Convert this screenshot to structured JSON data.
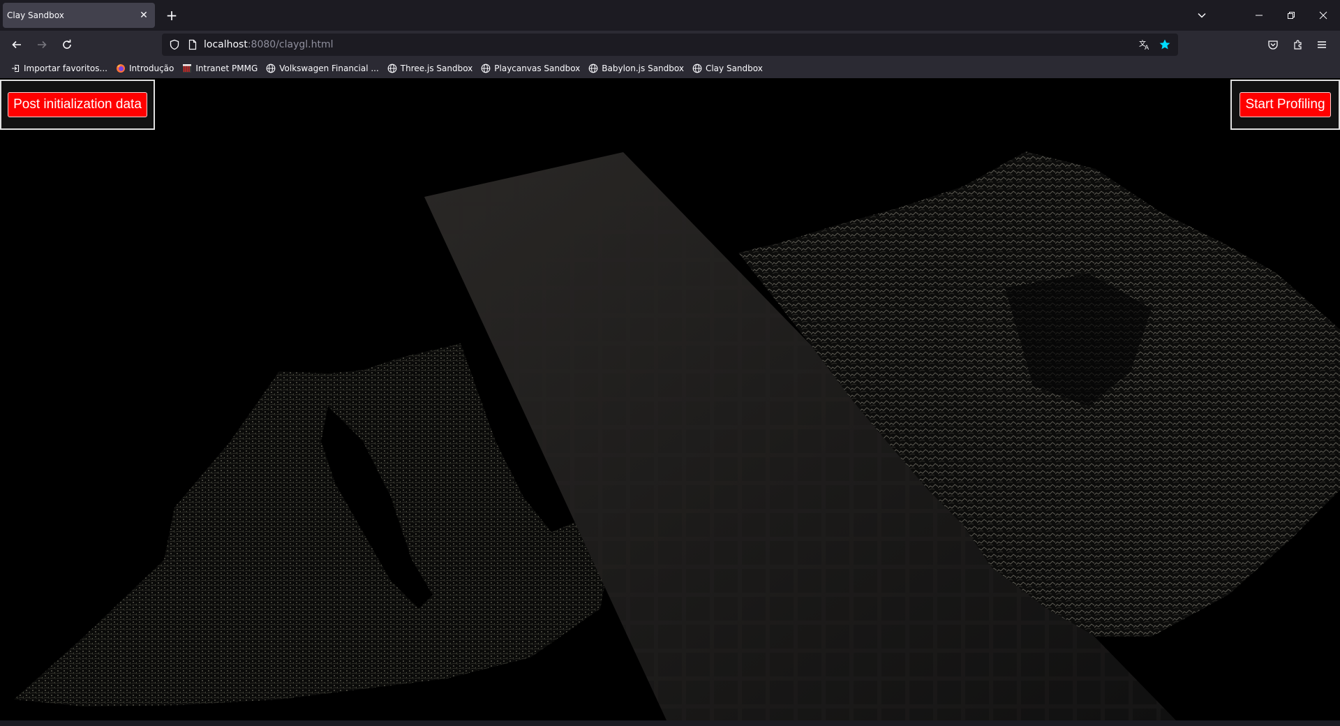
{
  "browser": {
    "tab": {
      "title": "Clay Sandbox",
      "close_icon": "close-icon"
    },
    "new_tab_label": "+",
    "url": {
      "host": "localhost",
      "rest": ":8080/claygl.html"
    },
    "bookmarks": [
      {
        "label": "Importar favoritos...",
        "icon": "import-icon"
      },
      {
        "label": "Introdução",
        "icon": "firefox-icon"
      },
      {
        "label": "Intranet PMMG",
        "icon": "pmmg-icon"
      },
      {
        "label": "Volkswagen Financial ...",
        "icon": "globe-icon"
      },
      {
        "label": "Three.js Sandbox",
        "icon": "globe-icon"
      },
      {
        "label": "Playcanvas Sandbox",
        "icon": "globe-icon"
      },
      {
        "label": "Babylon.js Sandbox",
        "icon": "globe-icon"
      },
      {
        "label": "Clay Sandbox",
        "icon": "globe-icon"
      }
    ]
  },
  "page": {
    "post_button_label": "Post initialization data",
    "profiling_button_label": "Start Profiling"
  }
}
